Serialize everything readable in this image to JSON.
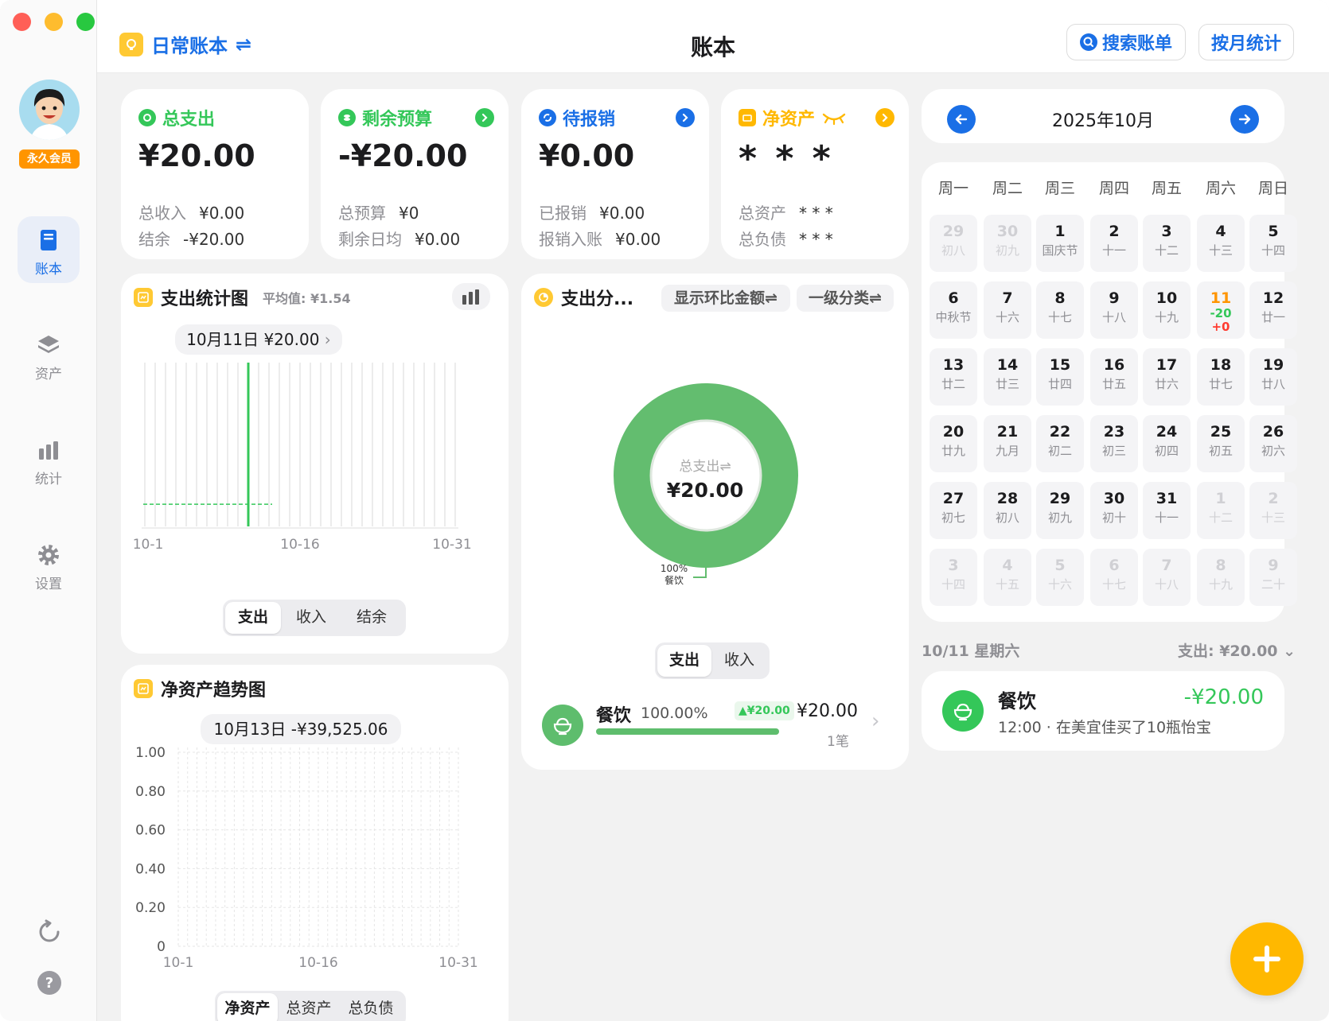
{
  "sidebar": {
    "vip_badge": "永久会员",
    "items": [
      {
        "label": "账本"
      },
      {
        "label": "资产"
      },
      {
        "label": "统计"
      },
      {
        "label": "设置"
      }
    ]
  },
  "header": {
    "book_name": "日常账本",
    "title": "账本",
    "search_label": "搜索账单",
    "monthly_label": "按月统计"
  },
  "summary": {
    "expense": {
      "title": "总支出",
      "value": "¥20.00",
      "row1_label": "总收入",
      "row1_value": "¥0.00",
      "row2_label": "结余",
      "row2_value": "-¥20.00"
    },
    "budget": {
      "title": "剩余预算",
      "value": "-¥20.00",
      "row1_label": "总预算",
      "row1_value": "¥0",
      "row2_label": "剩余日均",
      "row2_value": "¥0.00"
    },
    "reimburse": {
      "title": "待报销",
      "value": "¥0.00",
      "row1_label": "已报销",
      "row1_value": "¥0.00",
      "row2_label": "报销入账",
      "row2_value": "¥0.00"
    },
    "net": {
      "title": "净资产",
      "value": "* * *",
      "row1_label": "总资产",
      "row1_value": "* * *",
      "row2_label": "总负债",
      "row2_value": "* * *"
    }
  },
  "expense_chart": {
    "title": "支出统计图",
    "avg": "平均值: ¥1.54",
    "tooltip": "10月11日 ¥20.00",
    "tabs": [
      "支出",
      "收入",
      "结余"
    ],
    "active_tab": "支出"
  },
  "networth_chart": {
    "title": "净资产趋势图",
    "tooltip": "10月13日 -¥39,525.06",
    "tabs": [
      "净资产",
      "总资产",
      "总负债"
    ],
    "active_tab": "净资产"
  },
  "category": {
    "title": "支出分...",
    "btn1": "显示环比金额⇌",
    "btn2": "一级分类⇌",
    "center_label": "总支出⇌",
    "center_value": "¥20.00",
    "slice_pct": "100%",
    "slice_name": "餐饮",
    "tabs": [
      "支出",
      "收入"
    ],
    "active_tab": "支出",
    "item": {
      "name": "餐饮",
      "pct": "100.00%",
      "change": "▲¥20.00",
      "amount": "¥20.00",
      "count": "1笔",
      "progress": 1.0
    }
  },
  "calendar": {
    "month": "2025年10月",
    "weekdays": [
      "周一",
      "周二",
      "周三",
      "周四",
      "周五",
      "周六",
      "周日"
    ],
    "days": [
      {
        "n": "29",
        "l": "初八",
        "dim": true
      },
      {
        "n": "30",
        "l": "初九",
        "dim": true
      },
      {
        "n": "1",
        "l": "国庆节"
      },
      {
        "n": "2",
        "l": "十一"
      },
      {
        "n": "3",
        "l": "十二"
      },
      {
        "n": "4",
        "l": "十三"
      },
      {
        "n": "5",
        "l": "十四"
      },
      {
        "n": "6",
        "l": "中秋节"
      },
      {
        "n": "7",
        "l": "十六"
      },
      {
        "n": "8",
        "l": "十七"
      },
      {
        "n": "9",
        "l": "十八"
      },
      {
        "n": "10",
        "l": "十九"
      },
      {
        "n": "11",
        "l": "",
        "today": true,
        "exp": "-20",
        "inc": "+0"
      },
      {
        "n": "12",
        "l": "廿一"
      },
      {
        "n": "13",
        "l": "廿二"
      },
      {
        "n": "14",
        "l": "廿三"
      },
      {
        "n": "15",
        "l": "廿四"
      },
      {
        "n": "16",
        "l": "廿五"
      },
      {
        "n": "17",
        "l": "廿六"
      },
      {
        "n": "18",
        "l": "廿七"
      },
      {
        "n": "19",
        "l": "廿八"
      },
      {
        "n": "20",
        "l": "廿九"
      },
      {
        "n": "21",
        "l": "九月"
      },
      {
        "n": "22",
        "l": "初二"
      },
      {
        "n": "23",
        "l": "初三"
      },
      {
        "n": "24",
        "l": "初四"
      },
      {
        "n": "25",
        "l": "初五"
      },
      {
        "n": "26",
        "l": "初六"
      },
      {
        "n": "27",
        "l": "初七"
      },
      {
        "n": "28",
        "l": "初八"
      },
      {
        "n": "29",
        "l": "初九"
      },
      {
        "n": "30",
        "l": "初十"
      },
      {
        "n": "31",
        "l": "十一"
      },
      {
        "n": "1",
        "l": "十二",
        "dim": true
      },
      {
        "n": "2",
        "l": "十三",
        "dim": true
      },
      {
        "n": "3",
        "l": "十四",
        "dim": true
      },
      {
        "n": "4",
        "l": "十五",
        "dim": true
      },
      {
        "n": "5",
        "l": "十六",
        "dim": true
      },
      {
        "n": "6",
        "l": "十七",
        "dim": true
      },
      {
        "n": "7",
        "l": "十八",
        "dim": true
      },
      {
        "n": "8",
        "l": "十九",
        "dim": true
      },
      {
        "n": "9",
        "l": "二十",
        "dim": true
      }
    ]
  },
  "day_detail": {
    "date": "10/11 星期六",
    "total": "支出: ¥20.00",
    "record": {
      "category": "餐饮",
      "amount": "-¥20.00",
      "note": "12:00 · 在美宜佳买了10瓶怡宝"
    }
  },
  "colors": {
    "accent": "#1a6fe6",
    "green": "#5ebd6d",
    "expense_green": "#34c759",
    "orange": "#ff9500",
    "yellow": "#ffc933",
    "red": "#ff3b30"
  },
  "chart_data": [
    {
      "type": "bar",
      "title": "支出统计图",
      "categories": [
        "10-1",
        "10-2",
        "10-3",
        "10-4",
        "10-5",
        "10-6",
        "10-7",
        "10-8",
        "10-9",
        "10-10",
        "10-11",
        "10-12",
        "10-13",
        "10-14",
        "10-15",
        "10-16",
        "10-17",
        "10-18",
        "10-19",
        "10-20",
        "10-21",
        "10-22",
        "10-23",
        "10-24",
        "10-25",
        "10-26",
        "10-27",
        "10-28",
        "10-29",
        "10-30",
        "10-31"
      ],
      "x_tick_labels": [
        "10-1",
        "10-16",
        "10-31"
      ],
      "values": [
        0,
        0,
        0,
        0,
        0,
        0,
        0,
        0,
        0,
        0,
        20,
        0,
        0,
        0,
        0,
        0,
        0,
        0,
        0,
        0,
        0,
        0,
        0,
        0,
        0,
        0,
        0,
        0,
        0,
        0,
        0
      ],
      "average": 1.54
    },
    {
      "type": "line",
      "title": "净资产趋势图",
      "x_tick_labels": [
        "10-1",
        "10-16",
        "10-31"
      ],
      "y_tick_labels": [
        "1.00",
        "0.80",
        "0.60",
        "0.40",
        "0.20",
        "0"
      ],
      "ylim": [
        0,
        1
      ],
      "grid": true
    },
    {
      "type": "pie",
      "title": "支出分...",
      "labels": [
        "餐饮"
      ],
      "values": [
        20.0
      ],
      "percents": [
        100
      ]
    }
  ]
}
